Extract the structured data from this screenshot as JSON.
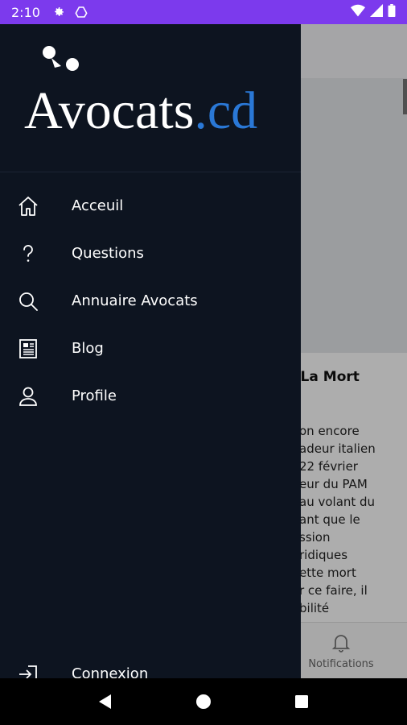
{
  "status_bar": {
    "time": "2:10",
    "left_icons": [
      "settings-icon",
      "drive-icon"
    ],
    "right_icons": [
      "wifi-icon",
      "signal-icon",
      "battery-icon"
    ],
    "color": "#7c3aed"
  },
  "drawer": {
    "logo": {
      "text_main": "Avocats",
      "text_suffix": ".cd",
      "suffix_color": "#2a78d6"
    },
    "menu": [
      {
        "label": "Acceuil",
        "icon": "home-icon"
      },
      {
        "label": "Questions",
        "icon": "question-icon"
      },
      {
        "label": "Annuaire Avocats",
        "icon": "search-icon"
      },
      {
        "label": "Blog",
        "icon": "newspaper-icon"
      },
      {
        "label": "Profile",
        "icon": "user-icon"
      }
    ],
    "footer_item": {
      "label": "Connexion",
      "icon": "login-icon"
    },
    "background": "#0d1420"
  },
  "background_app": {
    "article_title_fragment": "De La Mort",
    "article_lines": [
      "on encore",
      "adeur italien",
      "22 février",
      "eur du PAM",
      "au volant du",
      "ant que le",
      "ssion",
      "ridiques",
      "ette mort",
      "r ce faire, il",
      "bilité"
    ],
    "bottom_nav_label": "Notifications"
  },
  "system_nav": {
    "buttons": [
      "back-button",
      "home-button",
      "recents-button"
    ]
  }
}
